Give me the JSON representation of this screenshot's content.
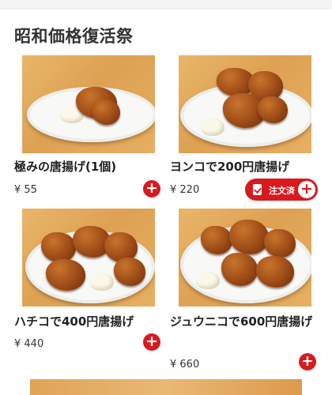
{
  "section": {
    "title": "昭和価格復活祭"
  },
  "items": [
    {
      "name": "極みの唐揚げ(1個)",
      "price": "¥ 55"
    },
    {
      "name": "ヨンコで200円唐揚げ",
      "price": "¥ 220",
      "ordered_label": "注文済"
    },
    {
      "name": "ハチコで400円唐揚げ",
      "price": "¥ 440"
    },
    {
      "name": "ジュウニコで600円唐揚げ",
      "price": "¥ 660"
    }
  ],
  "add_label": "+",
  "colors": {
    "accent": "#d81a1f",
    "wood": "#e2a85b"
  }
}
